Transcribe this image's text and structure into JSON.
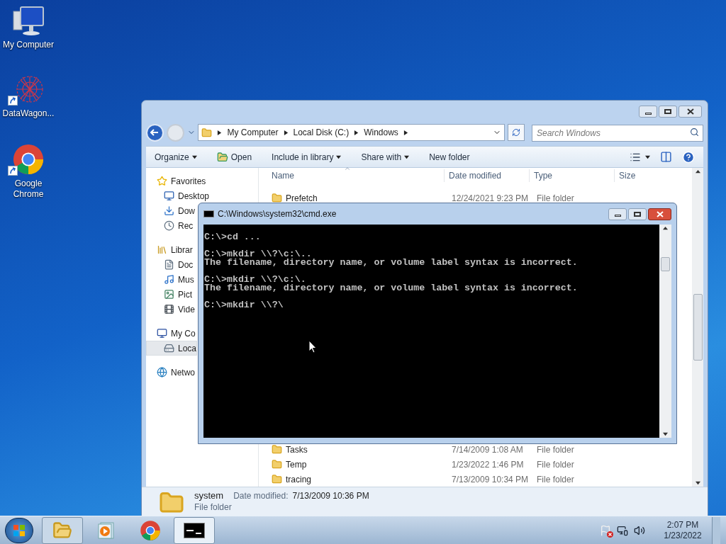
{
  "desktop_icons": [
    {
      "kind": "computer",
      "label": "My Computer",
      "shortcut": false
    },
    {
      "kind": "web",
      "label": "DataWagon...",
      "shortcut": true
    },
    {
      "kind": "chrome",
      "label": "Google Chrome",
      "shortcut": true
    }
  ],
  "explorer": {
    "breadcrumbs": [
      "My Computer",
      "Local Disk (C:)",
      "Windows"
    ],
    "search": {
      "placeholder": "Search Windows"
    },
    "toolbar": [
      {
        "kind": "menu",
        "label": "Organize"
      },
      {
        "kind": "open",
        "label": "Open"
      },
      {
        "kind": "menu",
        "label": "Include in library"
      },
      {
        "kind": "menu",
        "label": "Share with"
      },
      {
        "kind": "plain",
        "label": "New folder"
      }
    ],
    "sidebar": [
      {
        "kind": "star",
        "label": "Favorites",
        "selected": false,
        "children": [
          {
            "kind": "desktop",
            "label": "Desktop",
            "selected": false
          },
          {
            "kind": "downloads",
            "label": "Dow",
            "selected": false
          },
          {
            "kind": "recent",
            "label": "Rec",
            "selected": false
          }
        ]
      },
      {
        "kind": "library",
        "label": "Librar",
        "selected": false,
        "children": [
          {
            "kind": "document",
            "label": "Doc",
            "selected": false
          },
          {
            "kind": "music",
            "label": "Mus",
            "selected": false
          },
          {
            "kind": "picture",
            "label": "Pict",
            "selected": false
          },
          {
            "kind": "video",
            "label": "Vide",
            "selected": false
          }
        ]
      },
      {
        "kind": "computer",
        "label": "My Co",
        "selected": false,
        "children": [
          {
            "kind": "disk",
            "label": "Loca",
            "selected": true
          }
        ]
      },
      {
        "kind": "network",
        "label": "Netwo",
        "selected": false
      }
    ],
    "columns": [
      "Name",
      "Date modified",
      "Type",
      "Size"
    ],
    "rows_top": [
      {
        "name": "Prefetch",
        "date": "12/24/2021 9:23 PM",
        "type": "File folder"
      }
    ],
    "rows_bottom": [
      {
        "name": "Tasks",
        "date": "7/14/2009 1:08 AM",
        "type": "File folder"
      },
      {
        "name": "Temp",
        "date": "1/23/2022 1:46 PM",
        "type": "File folder"
      },
      {
        "name": "tracing",
        "date": "7/13/2009 10:34 PM",
        "type": "File folder"
      }
    ],
    "details": {
      "name": "system",
      "date_label": "Date modified:",
      "date": "7/13/2009 10:36 PM",
      "type": "File folder"
    }
  },
  "cmd": {
    "title": "C:\\Windows\\system32\\cmd.exe",
    "blocks": [
      [
        "C:\\>cd ..."
      ],
      [
        "C:\\>mkdir \\\\?\\c:\\..",
        "The filename, directory name, or volume label syntax is incorrect."
      ],
      [
        "C:\\>mkdir \\\\?\\c:\\.",
        "The filename, directory name, or volume label syntax is incorrect."
      ],
      [
        "C:\\>mkdir \\\\?\\"
      ]
    ]
  },
  "taskbar": {
    "items": [
      {
        "kind": "explorer",
        "running": true,
        "selected": false
      },
      {
        "kind": "media",
        "running": false,
        "selected": false
      },
      {
        "kind": "chrome",
        "running": false,
        "selected": false
      },
      {
        "kind": "console",
        "running": true,
        "selected": true
      }
    ],
    "time": "2:07 PM",
    "date": "1/23/2022"
  }
}
